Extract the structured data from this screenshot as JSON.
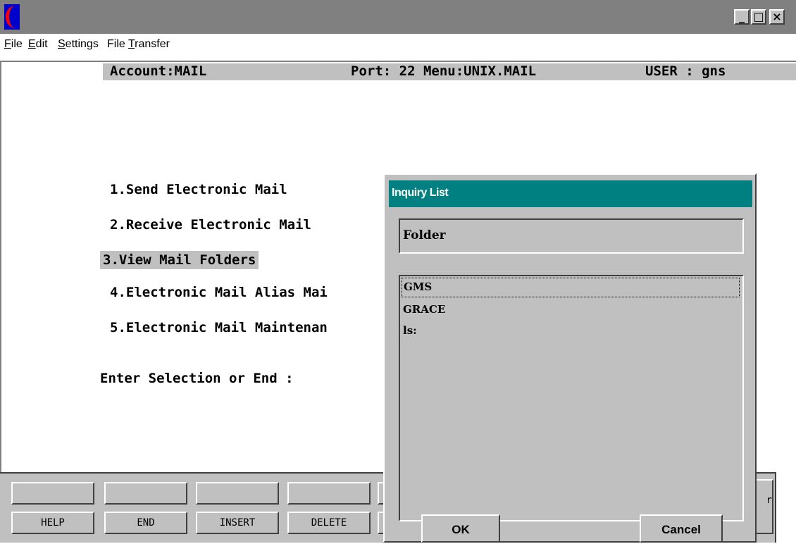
{
  "window": {
    "minimize_label": "_",
    "maximize_label": "□",
    "close_label": "×",
    "colors": {
      "titlebar": "#808080",
      "dialog_title": "#008080",
      "panel": "#c0c0c0"
    }
  },
  "menu": {
    "file": {
      "first": "F",
      "rest": "ile"
    },
    "edit": {
      "first": "E",
      "rest": "dit"
    },
    "settings": {
      "first": "S",
      "rest": "ettings"
    },
    "file_transfer": {
      "pre": "File ",
      "ul": "T",
      "rest": "ransfer"
    }
  },
  "status": {
    "account": "Account:MAIL",
    "port_menu": "Port: 22 Menu:UNIX.MAIL",
    "user": "USER : gns"
  },
  "options": [
    "1.Send Electronic Mail",
    "2.Receive Electronic Mail",
    "3.View Mail Folders",
    "4.Electronic Mail Alias Mai",
    "5.Electronic Mail Maintenan"
  ],
  "prompt": "Enter Selection or End :",
  "fkeys": {
    "top": [
      "",
      "",
      "",
      ""
    ],
    "bottom": [
      "HELP",
      "END",
      "INSERT",
      "DELETE"
    ],
    "partial_label": "r"
  },
  "dialog": {
    "title": "Inquiry List",
    "field_label": "Folder",
    "items": [
      "GMS",
      "GRACE",
      "ls:"
    ],
    "ok_label": "OK",
    "cancel_label": "Cancel"
  }
}
